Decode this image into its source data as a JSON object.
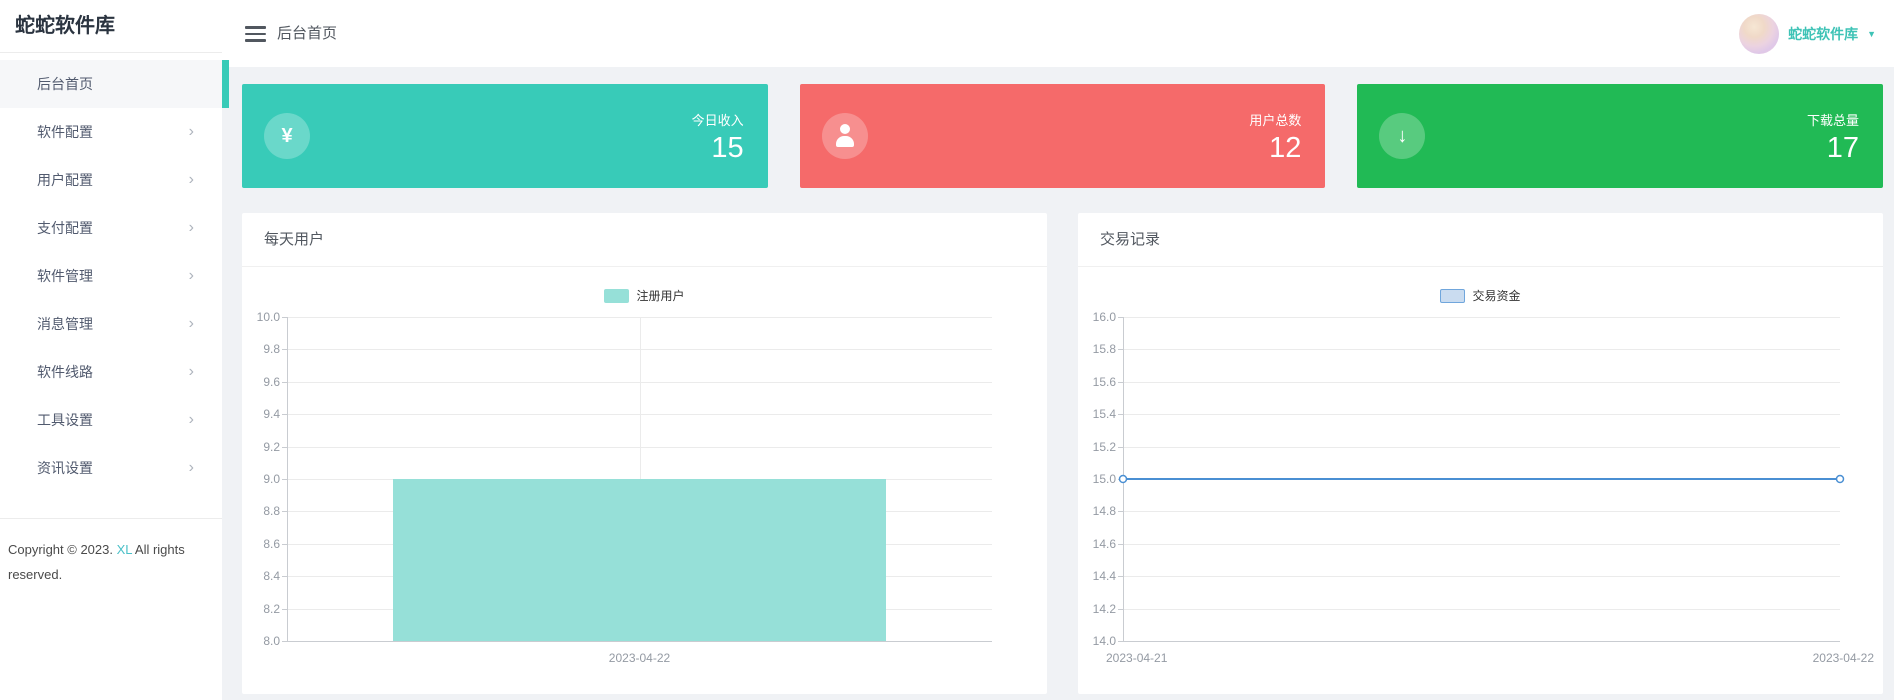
{
  "app": {
    "brand": "蛇蛇软件库"
  },
  "sidebar": {
    "logo": "蛇蛇软件库",
    "items": [
      {
        "label": "后台首页",
        "active": true,
        "has_children": false
      },
      {
        "label": "软件配置",
        "active": false,
        "has_children": true
      },
      {
        "label": "用户配置",
        "active": false,
        "has_children": true
      },
      {
        "label": "支付配置",
        "active": false,
        "has_children": true
      },
      {
        "label": "软件管理",
        "active": false,
        "has_children": true
      },
      {
        "label": "消息管理",
        "active": false,
        "has_children": true
      },
      {
        "label": "软件线路",
        "active": false,
        "has_children": true
      },
      {
        "label": "工具设置",
        "active": false,
        "has_children": true
      },
      {
        "label": "资讯设置",
        "active": false,
        "has_children": true
      }
    ],
    "copyright_prefix": "Copyright © 2023. ",
    "copyright_link": "XL",
    "copyright_suffix": " All rights reserved."
  },
  "header": {
    "title": "后台首页",
    "user_name": "蛇蛇软件库",
    "caret": "▼"
  },
  "cards": [
    {
      "label": "今日收入",
      "value": "15",
      "color": "#38cbb8",
      "icon": "yen-icon"
    },
    {
      "label": "用户总数",
      "value": "12",
      "color": "#f56a6a",
      "icon": "user-icon"
    },
    {
      "label": "下载总量",
      "value": "17",
      "color": "#21ba55",
      "icon": "download-icon"
    }
  ],
  "panels": [
    {
      "title": "每天用户"
    },
    {
      "title": "交易记录"
    }
  ],
  "chart_data": [
    {
      "type": "bar",
      "title": "每天用户",
      "legend": "注册用户",
      "categories": [
        "2023-04-22"
      ],
      "values": [
        9
      ],
      "ylim": [
        8.0,
        10.0
      ],
      "ystep": 0.2,
      "grid": true,
      "legend_position": "top-center",
      "bar_color": "#96e0d8",
      "swatch_fill": "#96e0d8",
      "swatch_border": "#96e0d8"
    },
    {
      "type": "line",
      "title": "交易记录",
      "legend": "交易资金",
      "categories": [
        "2023-04-21",
        "2023-04-22"
      ],
      "values": [
        15,
        15
      ],
      "ylim": [
        14.0,
        16.0
      ],
      "ystep": 0.2,
      "grid": true,
      "legend_position": "top-center",
      "line_color": "#4a8fd3",
      "marker": "hollow-circle",
      "swatch_fill": "#cadcf0",
      "swatch_border": "#70a6dc"
    }
  ]
}
